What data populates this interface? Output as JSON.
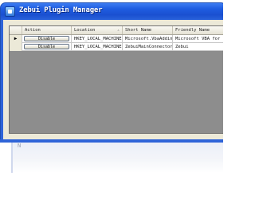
{
  "window": {
    "title": "Zebui Plugin Manager"
  },
  "grid": {
    "columns": [
      "Action",
      "Location",
      "Short Name",
      "Friendly Name"
    ],
    "rows": [
      {
        "action": "Disable",
        "location": "HKEY_LOCAL_MACHINE",
        "short_name": "Microsoft.VbaAddin...",
        "friendly_name": "Microsoft VBA for ..."
      },
      {
        "action": "Disable",
        "location": "HKEY_LOCAL_MACHINE",
        "short_name": "ZebuiMainConnector...",
        "friendly_name": "Zebui"
      }
    ]
  },
  "reflection_glyph": "N"
}
